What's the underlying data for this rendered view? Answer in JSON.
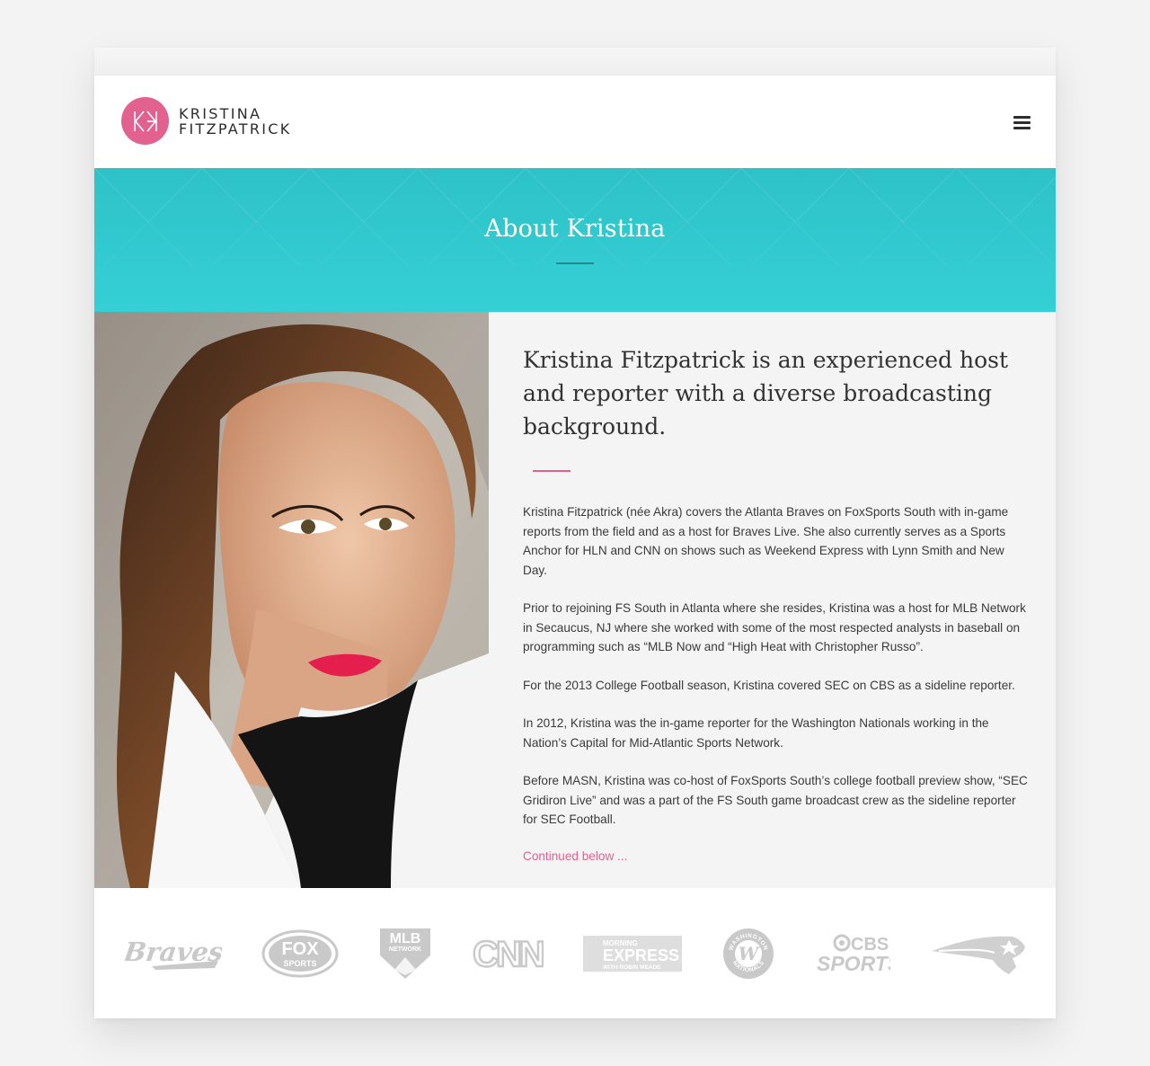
{
  "header": {
    "logo_monogram": "KF",
    "logo_line1": "KRISTINA",
    "logo_line2": "FITZPATRICK",
    "menu_icon": "hamburger-icon"
  },
  "hero": {
    "title": "About Kristina"
  },
  "bio": {
    "headline": "Kristina Fitzpatrick is an experienced host and reporter with a diverse broadcasting background.",
    "paragraphs": [
      "Kristina Fitzpatrick (née Akra) covers the Atlanta Braves on FoxSports South with in-game reports from the field and as a host for Braves Live. She also currently serves as a Sports Anchor for HLN and CNN on shows such as Weekend Express with Lynn Smith and New Day.",
      "Prior to rejoining FS South in Atlanta where she resides, Kristina was a host for MLB Network in Secaucus, NJ where she worked with some of the most respected analysts in baseball on programming such as “MLB Now and “High Heat with Christopher Russo”.",
      "For the 2013 College Football season, Kristina covered SEC on CBS as a sideline reporter.",
      "In 2012, Kristina was the in-game reporter for the Washington Nationals working in the Nation’s Capital for Mid-Atlantic Sports Network.",
      "Before MASN, Kristina was co-host of FoxSports South’s college football preview show, “SEC Gridiron Live” and was a part of the FS South game broadcast crew as the sideline reporter for SEC Football."
    ],
    "continue_link": "Continued below ..."
  },
  "logos": {
    "braves": "Braves",
    "fox_top": "FOX",
    "fox_bottom": "SPORTS",
    "mlb_top": "MLB",
    "mlb_bottom": "NETWORK",
    "cnn": "CNN",
    "express_top": "MORNING",
    "express_mid": "EXPRESS",
    "express_bottom": "WITH ROBIN MEADE",
    "nationals_arc_top": "WASHINGTON",
    "nationals_arc_bottom": "NATIONALS",
    "nationals_letter": "W",
    "cbs_top": "CBS",
    "cbs_bottom": "SPORTS"
  },
  "colors": {
    "accent_pink": "#e2618f",
    "hero_teal": "#34d0d6",
    "bio_background": "#f4f4f4",
    "logo_gray": "#c9c9c9"
  }
}
